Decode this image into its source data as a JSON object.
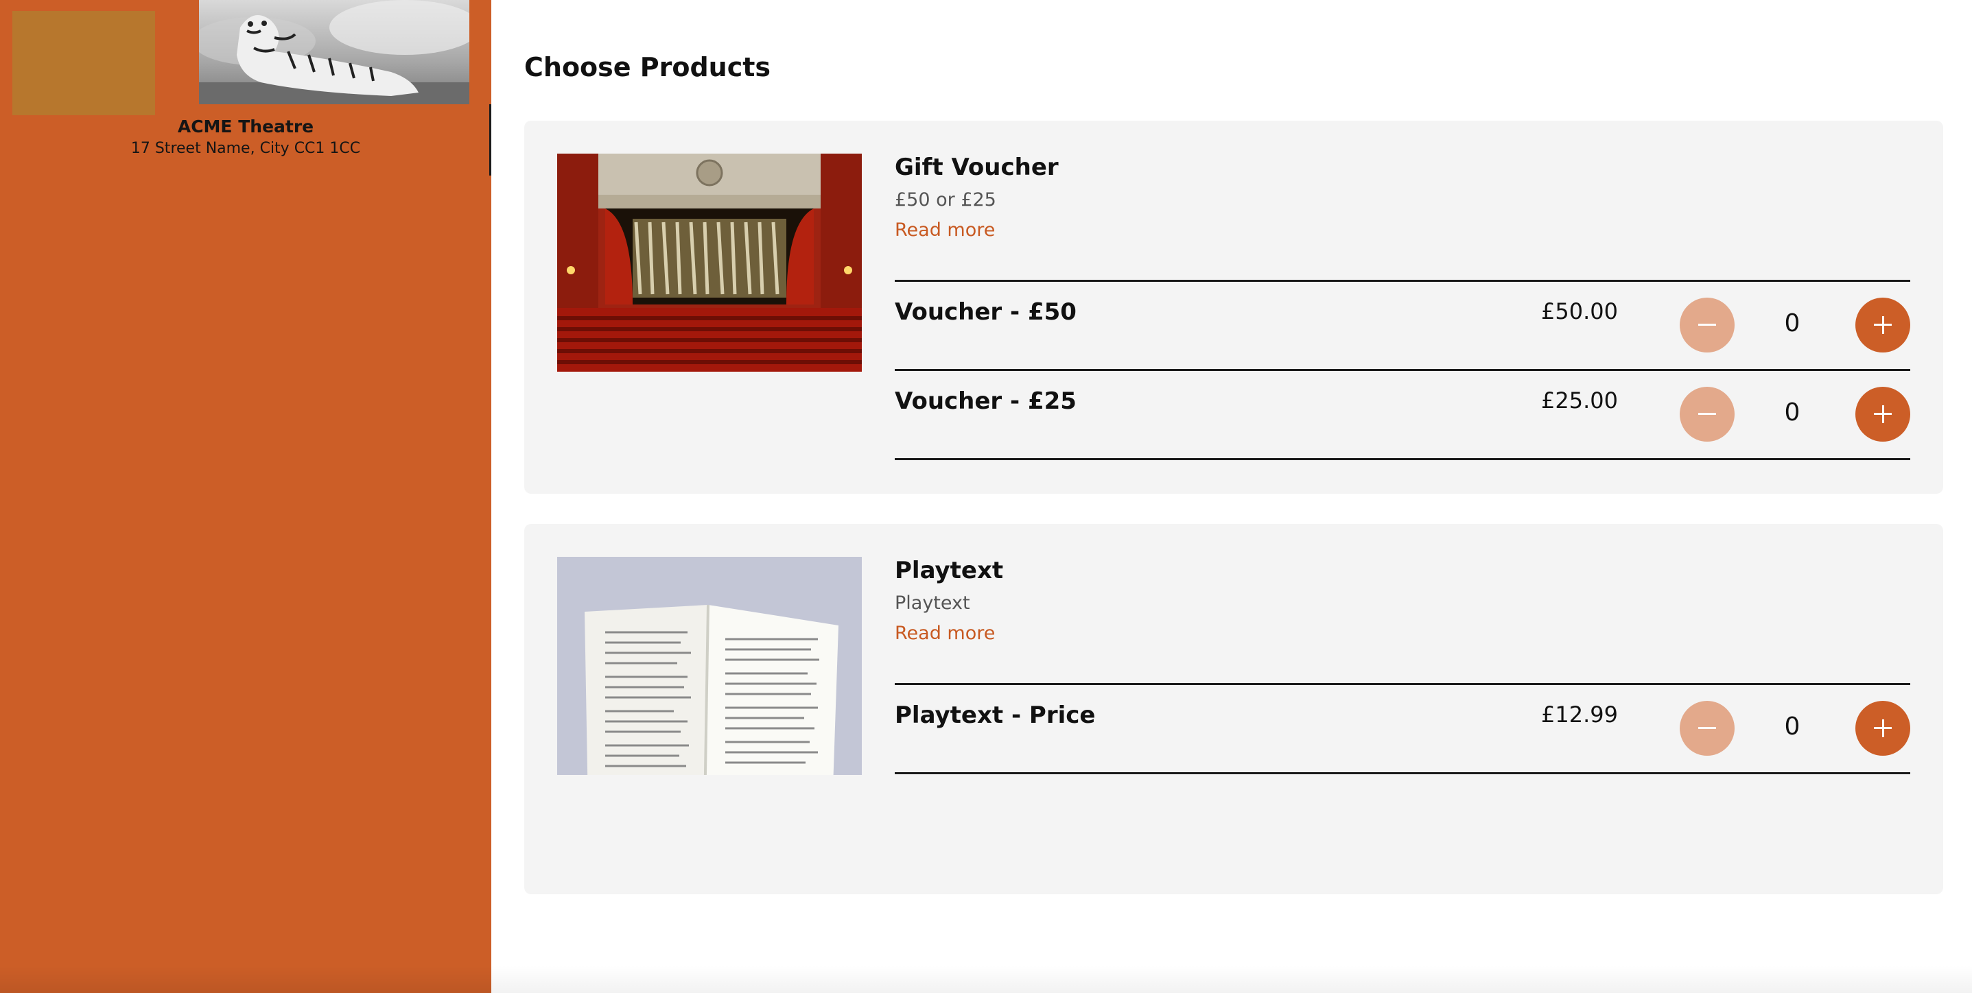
{
  "venue": {
    "name": "ACME Theatre",
    "address": "17 Street Name, City CC1 1CC"
  },
  "page": {
    "title": "Choose Products"
  },
  "colors": {
    "accent": "#cc5e27",
    "accent_light": "#e3a98b",
    "card_bg": "#f4f4f4",
    "link": "#c85a22"
  },
  "products": [
    {
      "title": "Gift Voucher",
      "subtitle": "£50 or £25",
      "read_more": "Read more",
      "image": "theatre-stage-image",
      "options": [
        {
          "name": "Voucher - £50",
          "price": "£50.00",
          "quantity": "0"
        },
        {
          "name": "Voucher - £25",
          "price": "£25.00",
          "quantity": "0"
        }
      ]
    },
    {
      "title": "Playtext",
      "subtitle": "Playtext",
      "read_more": "Read more",
      "image": "open-book-image",
      "options": [
        {
          "name": "Playtext - Price",
          "price": "£12.99",
          "quantity": "0"
        }
      ]
    }
  ],
  "icons": {
    "decrease": "minus-icon",
    "increase": "plus-icon"
  }
}
